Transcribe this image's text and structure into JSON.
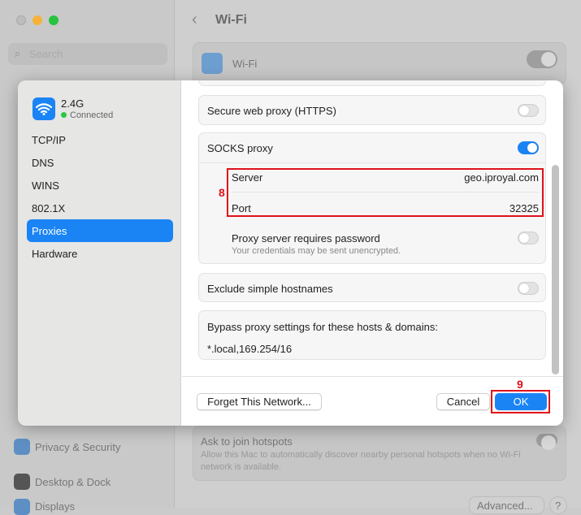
{
  "background": {
    "search_placeholder": "Search",
    "title": "Wi-Fi",
    "wifi_label": "Wi-Fi",
    "sidebar_items": [
      "Privacy & Security",
      "Desktop & Dock",
      "Displays"
    ],
    "hotspots_title": "Ask to join hotspots",
    "hotspots_desc": "Allow this Mac to automatically discover nearby personal hotspots when no Wi-Fi network is available.",
    "advanced_label": "Advanced...",
    "help_label": "?"
  },
  "modal": {
    "network_name": "2.4G",
    "network_status": "Connected",
    "nav": [
      "TCP/IP",
      "DNS",
      "WINS",
      "802.1X",
      "Proxies",
      "Hardware"
    ],
    "selected_nav": "Proxies",
    "https_proxy": {
      "label": "Secure web proxy (HTTPS)",
      "enabled": false
    },
    "socks_proxy": {
      "label": "SOCKS proxy",
      "enabled": true,
      "server_label": "Server",
      "server_value": "geo.iproyal.com",
      "port_label": "Port",
      "port_value": "32325",
      "password_label": "Proxy server requires password",
      "password_desc": "Your credentials may be sent unencrypted.",
      "password_enabled": false
    },
    "exclude": {
      "label": "Exclude simple hostnames",
      "enabled": false
    },
    "bypass": {
      "label": "Bypass proxy settings for these hosts & domains:",
      "value": "*.local,169.254/16"
    },
    "forget_label": "Forget This Network...",
    "cancel_label": "Cancel",
    "ok_label": "OK"
  },
  "annotations": {
    "server_port": "8",
    "ok": "9"
  },
  "colors": {
    "accent": "#1a84f5",
    "annotation": "#e0101a"
  }
}
